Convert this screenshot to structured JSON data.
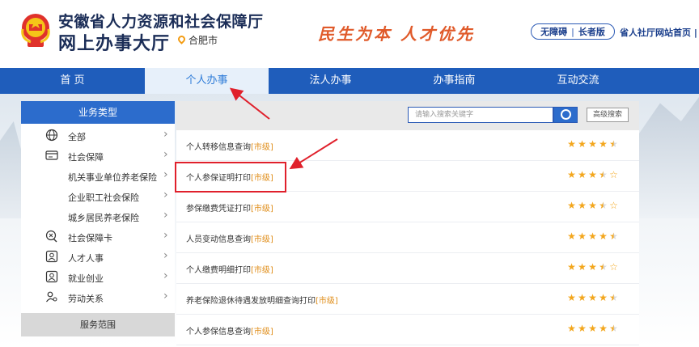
{
  "header": {
    "title_line1": "安徽省人力资源和社会保障厅",
    "title_line2": "网上办事大厅",
    "city": "合肥市",
    "slogan": "民生为本 人才优先",
    "accessibility": "无障碍",
    "elder_mode": "长者版",
    "separator": "|",
    "home_link": "省人社厅网站首页 |"
  },
  "nav": [
    {
      "label": "首 页"
    },
    {
      "label": "个人办事"
    },
    {
      "label": "法人办事"
    },
    {
      "label": "办事指南"
    },
    {
      "label": "互动交流"
    }
  ],
  "sidebar": {
    "header": "业务类型",
    "items": [
      {
        "label": "全部",
        "icon": "globe-icon",
        "type": "cat"
      },
      {
        "label": "社会保障",
        "icon": "card-icon",
        "type": "cat"
      },
      {
        "label": "机关事业单位养老保险",
        "type": "sub"
      },
      {
        "label": "企业职工社会保险",
        "type": "sub"
      },
      {
        "label": "城乡居民养老保险",
        "type": "sub"
      },
      {
        "label": "社会保障卡",
        "icon": "social-card-icon",
        "type": "cat"
      },
      {
        "label": "人才人事",
        "icon": "talent-icon",
        "type": "cat"
      },
      {
        "label": "就业创业",
        "icon": "employment-icon",
        "type": "cat"
      },
      {
        "label": "劳动关系",
        "icon": "labor-icon",
        "type": "cat"
      }
    ],
    "chevron": "›",
    "footer": "服务范围"
  },
  "search": {
    "placeholder": "请输入搜索关键字",
    "advanced_label": "高级搜索"
  },
  "services": [
    {
      "title": "个人转移信息查询",
      "level": "[市级]",
      "rating": 4.5
    },
    {
      "title": "个人参保证明打印",
      "level": "[市级]",
      "rating": 3.5
    },
    {
      "title": "参保缴费凭证打印",
      "level": "[市级]",
      "rating": 3.5
    },
    {
      "title": "人员变动信息查询",
      "level": "[市级]",
      "rating": 4.5
    },
    {
      "title": "个人缴费明细打印",
      "level": "[市级]",
      "rating": 3.5
    },
    {
      "title": "养老保险退休待遇发放明细查询打印",
      "level": "[市级]",
      "rating": 4.5
    },
    {
      "title": "个人参保信息查询",
      "level": "[市级]",
      "rating": 4.5
    }
  ],
  "colors": {
    "nav_blue": "#1f5dbb",
    "accent_orange": "#e08e1a",
    "star": "#f3a61c",
    "highlight_red": "#e0202b"
  }
}
